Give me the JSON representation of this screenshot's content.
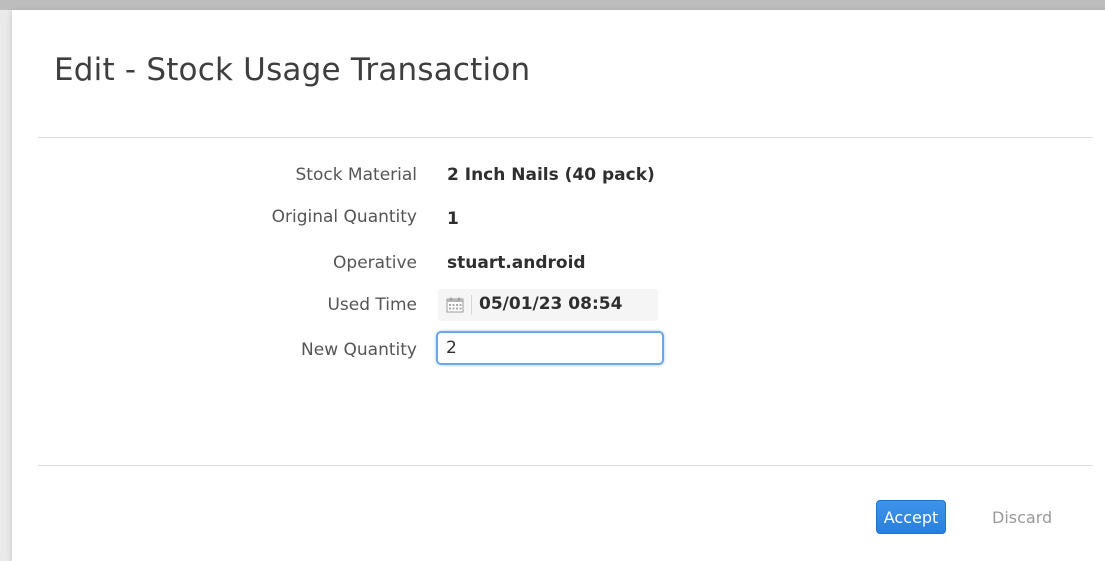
{
  "dialog": {
    "title": "Edit - Stock Usage Transaction"
  },
  "fields": {
    "stock_material": {
      "label": "Stock Material",
      "value": "2 Inch Nails (40 pack)"
    },
    "original_quantity": {
      "label": "Original Quantity",
      "value": "1"
    },
    "operative": {
      "label": "Operative",
      "value": "stuart.android"
    },
    "used_time": {
      "label": "Used Time",
      "value": "05/01/23 08:54",
      "icon": "calendar-icon"
    },
    "new_quantity": {
      "label": "New Quantity",
      "value": "2"
    }
  },
  "actions": {
    "accept_label": "Accept",
    "discard_label": "Discard"
  },
  "colors": {
    "accent": "#2a7fdc",
    "input_focus": "#6aa7e6"
  }
}
